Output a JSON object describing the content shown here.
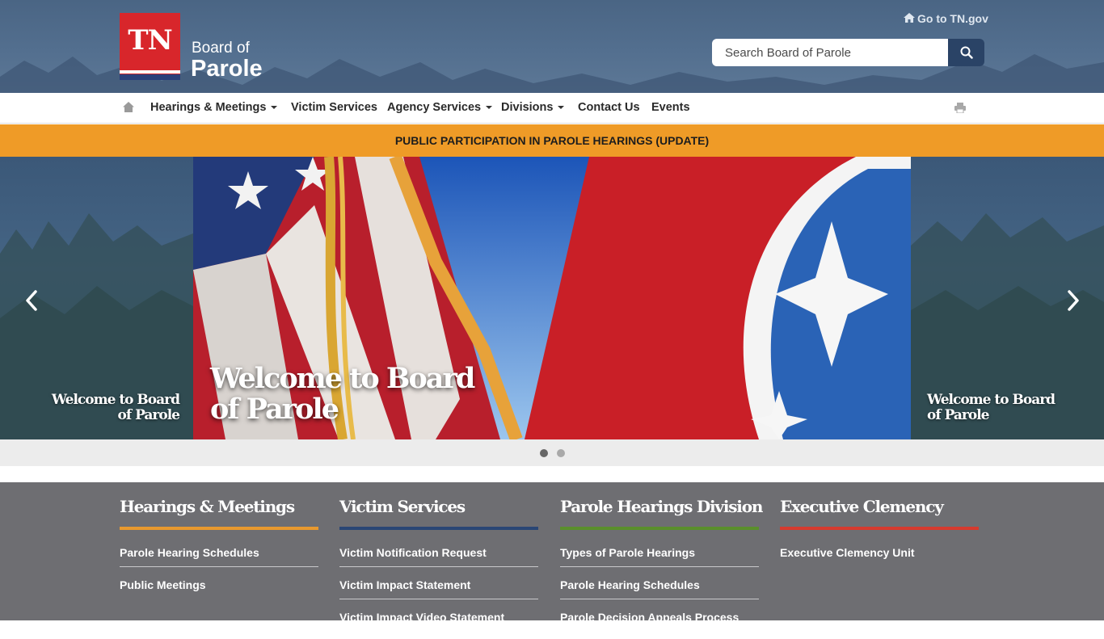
{
  "header": {
    "logo_text": "TN",
    "org_line1": "Board of",
    "org_line2": "Parole",
    "gotn_label": "Go to TN.gov",
    "search_placeholder": "Search Board of Parole"
  },
  "nav": {
    "items": [
      {
        "label": "Hearings & Meetings"
      },
      {
        "label": "Victim Services"
      },
      {
        "label": "Agency Services"
      },
      {
        "label": "Divisions"
      },
      {
        "label": "Contact Us"
      },
      {
        "label": "Events"
      }
    ]
  },
  "alert": {
    "text": "PUBLIC PARTICIPATION IN PAROLE HEARINGS (UPDATE)"
  },
  "carousel": {
    "main_caption": "Welcome to Board of Parole",
    "left_caption": "Welcome to Board of Parole",
    "right_caption": "Welcome to Board of Parole",
    "slide_count": 2,
    "active_slide": 1
  },
  "columns": [
    {
      "title": "Hearings & Meetings",
      "color": "#e8992e",
      "links": [
        "Parole Hearing Schedules",
        "Public Meetings"
      ]
    },
    {
      "title": "Victim Services",
      "color": "#2a4675",
      "links": [
        "Victim Notification Request",
        "Victim Impact Statement",
        "Victim Impact Video Statement"
      ]
    },
    {
      "title": "Parole Hearings Division",
      "color": "#5a8f2c",
      "links": [
        "Types of Parole Hearings",
        "Parole Hearing Schedules",
        "Parole Decision Appeals Process"
      ]
    },
    {
      "title": "Executive Clemency",
      "color": "#d63a2e",
      "links": [
        "Executive Clemency Unit"
      ]
    }
  ],
  "colors": {
    "header": "#4f6a8a",
    "alert": "#ef9b27",
    "footer": "#6e6e72",
    "brand_red": "#d8262b",
    "brand_blue": "#2a4366"
  }
}
